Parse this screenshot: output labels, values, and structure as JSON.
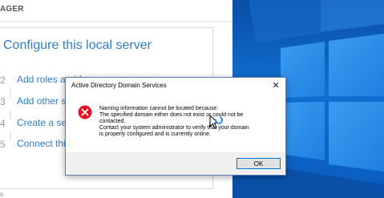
{
  "server_manager": {
    "header_title": "AGER",
    "panel_title": "Configure this local server",
    "steps": [
      {
        "num": "2",
        "label": "Add roles and f"
      },
      {
        "num": "3",
        "label": "Add other s"
      },
      {
        "num": "4",
        "label": "Create a ser"
      },
      {
        "num": "5",
        "label": "Connect thi"
      }
    ],
    "bottom_text": "s"
  },
  "dialog": {
    "title": "Active Directory Domain Services",
    "close_glyph": "✕",
    "message_lines": [
      "Naming information cannot be located because:",
      "The specified domain either does not exist or could not be",
      "contacted.",
      "Contact your system administrator to verify that your domain",
      "is properly configured and is currently online."
    ],
    "ok_label": "OK",
    "icon": "error-icon"
  },
  "colors": {
    "link_blue": "#2f7ec4",
    "error_red": "#e81123",
    "desktop_blue": "#0f6fd0"
  }
}
